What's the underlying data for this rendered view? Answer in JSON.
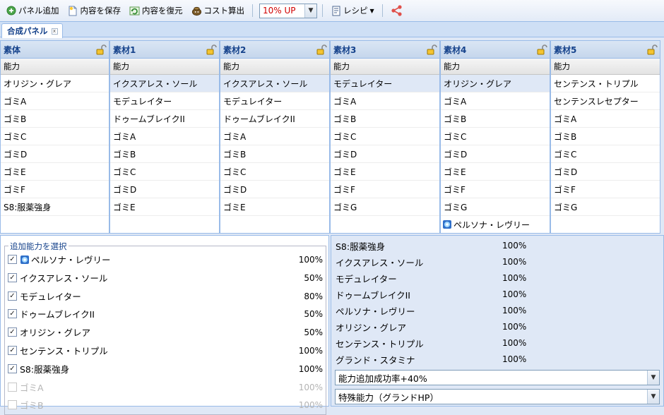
{
  "toolbar": {
    "add_panel": "パネル追加",
    "save": "内容を保存",
    "restore": "内容を復元",
    "cost": "コスト算出",
    "rate_value": "10% UP",
    "recipe": "レシピ"
  },
  "tab": {
    "label": "合成パネル"
  },
  "grid": {
    "sub_label": "能力",
    "columns": [
      {
        "title": "素体",
        "rows": [
          "オリジン・グレア",
          "ゴミA",
          "ゴミB",
          "ゴミC",
          "ゴミD",
          "ゴミE",
          "ゴミF",
          "S8:服薬強身",
          ""
        ]
      },
      {
        "title": "素材1",
        "rows": [
          "イクスアレス・ソール",
          "モデュレイター",
          "ドゥームブレイクII",
          "ゴミA",
          "ゴミB",
          "ゴミC",
          "ゴミD",
          "ゴミE",
          ""
        ]
      },
      {
        "title": "素材2",
        "rows": [
          "イクスアレス・ソール",
          "モデュレイター",
          "ドゥームブレイクII",
          "ゴミA",
          "ゴミB",
          "ゴミC",
          "ゴミD",
          "ゴミE",
          ""
        ]
      },
      {
        "title": "素材3",
        "rows": [
          "モデュレイター",
          "ゴミA",
          "ゴミB",
          "ゴミC",
          "ゴミD",
          "ゴミE",
          "ゴミF",
          "ゴミG",
          ""
        ]
      },
      {
        "title": "素材4",
        "rows": [
          "オリジン・グレア",
          "ゴミA",
          "ゴミB",
          "ゴミC",
          "ゴミD",
          "ゴミE",
          "ゴミF",
          "ゴミG",
          "ペルソナ・レヴリー"
        ]
      },
      {
        "title": "素材5",
        "rows": [
          "センテンス・トリプル",
          "センテンスレセプター",
          "ゴミA",
          "ゴミB",
          "ゴミC",
          "ゴミD",
          "ゴミF",
          "ゴミG",
          ""
        ]
      }
    ]
  },
  "select_panel": {
    "legend": "追加能力を選択",
    "items": [
      {
        "label": "ペルソナ・レヴリー",
        "pct": "100%",
        "checked": "✓"
      },
      {
        "label": "イクスアレス・ソール",
        "pct": "50%",
        "checked": "✓"
      },
      {
        "label": "モデュレイター",
        "pct": "80%",
        "checked": "✓"
      },
      {
        "label": "ドゥームブレイクII",
        "pct": "50%",
        "checked": "✓"
      },
      {
        "label": "オリジン・グレア",
        "pct": "50%",
        "checked": "✓"
      },
      {
        "label": "センテンス・トリプル",
        "pct": "100%",
        "checked": "✓"
      },
      {
        "label": "S8:服薬強身",
        "pct": "100%",
        "checked": "✓"
      },
      {
        "label": "ゴミA",
        "pct": "100%",
        "checked": ""
      },
      {
        "label": "ゴミB",
        "pct": "100%",
        "checked": ""
      }
    ]
  },
  "results": {
    "items": [
      {
        "label": "S8:服薬強身",
        "pct": "100%"
      },
      {
        "label": "イクスアレス・ソール",
        "pct": "100%"
      },
      {
        "label": "モデュレイター",
        "pct": "100%"
      },
      {
        "label": "ドゥームブレイクII",
        "pct": "100%"
      },
      {
        "label": "ペルソナ・レヴリー",
        "pct": "100%"
      },
      {
        "label": "オリジン・グレア",
        "pct": "100%"
      },
      {
        "label": "センテンス・トリプル",
        "pct": "100%"
      },
      {
        "label": "グランド・スタミナ",
        "pct": "100%"
      }
    ],
    "select1": "能力追加成功率+40%",
    "select2": "特殊能力（グランドHP）"
  },
  "colors": {
    "accent": "#15428b",
    "rate_text": "#d00000",
    "share": "#e0504a"
  }
}
